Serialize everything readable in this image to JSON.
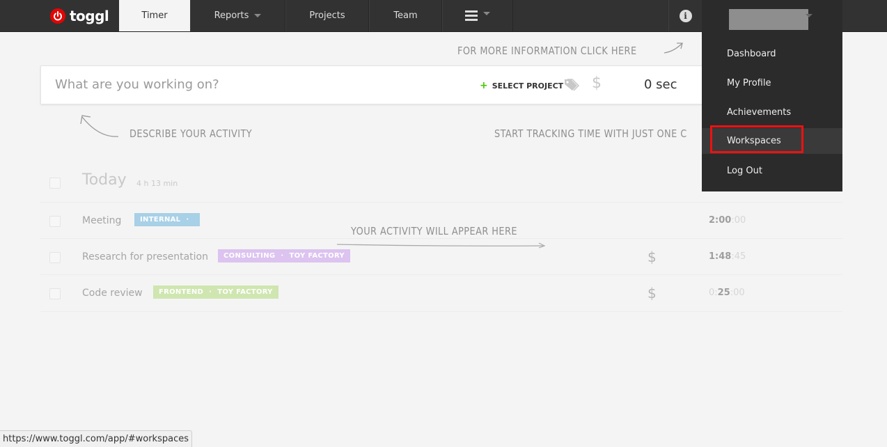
{
  "app": {
    "logo_text": "toggl"
  },
  "nav": {
    "tabs": [
      {
        "label": "Timer"
      },
      {
        "label": "Reports"
      },
      {
        "label": "Projects"
      },
      {
        "label": "Team"
      }
    ]
  },
  "hints": {
    "more_info": "FOR MORE INFORMATION CLICK HERE",
    "describe": "DESCRIBE YOUR ACTIVITY",
    "start_tracking": "START TRACKING TIME WITH JUST ONE C",
    "activity_appear": "YOUR ACTIVITY WILL APPEAR HERE"
  },
  "timer": {
    "placeholder": "What are you working on?",
    "select_project": "SELECT PROJECT",
    "duration": "0 sec"
  },
  "today": {
    "label": "Today",
    "total": "4 h 13 min"
  },
  "entries": [
    {
      "title": "Meeting",
      "project": "INTERNAL",
      "client": "",
      "color": "#a8d0e6",
      "billable": false,
      "duration_main": "2:00",
      "duration_sec": ":00",
      "duration_prefix": ""
    },
    {
      "title": "Research for presentation",
      "project": "CONSULTING",
      "client": "TOY FACTORY",
      "color": "#dcc3f0",
      "billable": true,
      "duration_main": "1:48",
      "duration_sec": ":45",
      "duration_prefix": ""
    },
    {
      "title": "Code review",
      "project": "FRONTEND",
      "client": "TOY FACTORY",
      "color": "#cfe6b0",
      "billable": true,
      "duration_main": "25",
      "duration_sec": ":00",
      "duration_prefix": "0:"
    }
  ],
  "user_menu": {
    "items": [
      {
        "label": "Dashboard"
      },
      {
        "label": "My Profile"
      },
      {
        "label": "Achievements"
      },
      {
        "label": "Workspaces"
      },
      {
        "label": "Log Out"
      }
    ],
    "highlight_color": "#ee1111"
  },
  "status_bar": {
    "url": "https://www.toggl.com/app/#workspaces"
  }
}
